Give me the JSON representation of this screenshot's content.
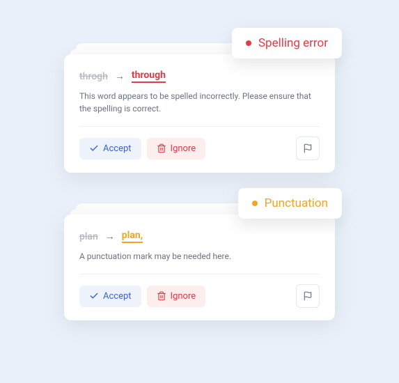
{
  "cards": [
    {
      "badge_type": "spelling",
      "badge_label": "Spelling error",
      "old_word": "throgh",
      "new_word": "through",
      "description": "This word appears to be spelled incorrectly. Please ensure that the spelling is correct.",
      "accept_label": "Accept",
      "ignore_label": "Ignore"
    },
    {
      "badge_type": "punctuation",
      "badge_label": "Punctuation",
      "old_word": "plan",
      "new_word": "plan,",
      "description": "A punctuation mark may be needed here.",
      "accept_label": "Accept",
      "ignore_label": "Ignore"
    }
  ],
  "colors": {
    "spelling": "#e63946",
    "punctuation": "#f4a520",
    "accept": "#3a63d6"
  }
}
